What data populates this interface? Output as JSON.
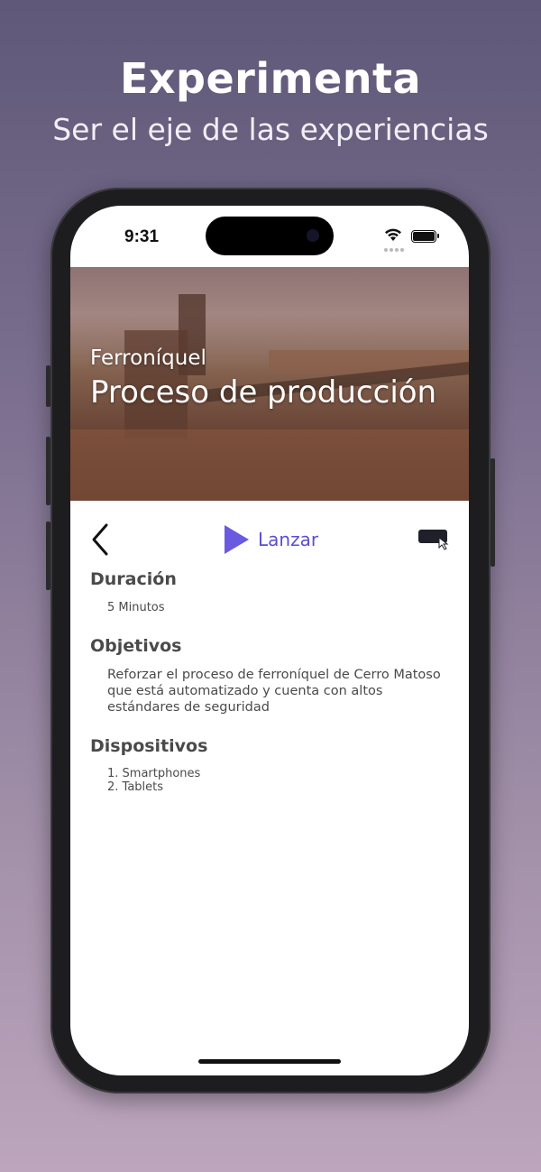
{
  "promo": {
    "title": "Experimenta",
    "subtitle": "Ser el eje de las experiencias"
  },
  "status_bar": {
    "time": "9:31"
  },
  "hero": {
    "subtitle": "Ferroníquel",
    "title": "Proceso de producción"
  },
  "toolbar": {
    "back_icon": "chevron-left-icon",
    "launch_label": "Lanzar",
    "launch_icon": "play-icon",
    "device_icon": "device-touch-icon",
    "accent_color": "#5a4fcf"
  },
  "sections": {
    "duration": {
      "title": "Duración",
      "value": "5 Minutos"
    },
    "objectives": {
      "title": "Objetivos",
      "text": "Reforzar el proceso de ferroníquel de Cerro Matoso que está automatizado y cuenta con altos estándares de seguridad"
    },
    "devices": {
      "title": "Dispositivos",
      "items": [
        "1. Smartphones",
        "2. Tablets"
      ]
    }
  }
}
